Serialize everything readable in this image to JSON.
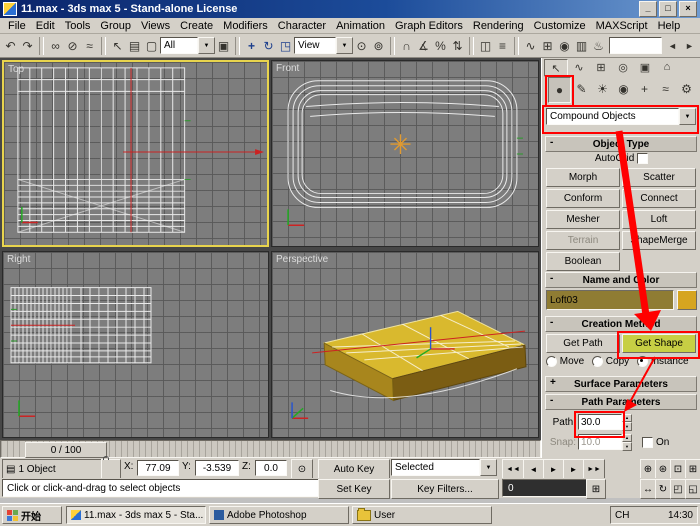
{
  "title_bar": {
    "title": "11.max - 3ds max 5 - Stand-alone License",
    "minimize": "_",
    "maximize": "□",
    "close": "×"
  },
  "menu_bar": {
    "items": [
      "File",
      "Edit",
      "Tools",
      "Group",
      "Views",
      "Create",
      "Modifiers",
      "Character",
      "Animation",
      "Graph Editors",
      "Rendering",
      "Customize",
      "MAXScript",
      "Help"
    ]
  },
  "toolbar": {
    "selection_filter": "All",
    "coord_system": "View"
  },
  "icons": {
    "undo": "↶",
    "redo": "↷",
    "select_link": "∞",
    "unlink": "⊘",
    "bind_spacewarp": "≈",
    "select_object": "↖",
    "select_by_name": "▤",
    "region_select": "▢",
    "window_crossing": "▣",
    "select_move": "+",
    "select_rotate": "↻",
    "select_scale": "◳",
    "use_center": "⊙",
    "manipulate": "⊚",
    "snap_toggle": "∩",
    "angle_snap": "∡",
    "percent_snap": "%",
    "spinner_snap": "⇅",
    "mirror": "◫",
    "align": "≡",
    "curve_editor": "∿",
    "schematic_view": "⊞",
    "material_editor": "◉",
    "render_scene": "▥",
    "quick_render": "♨",
    "scroll_left": "◄",
    "scroll_right": "►",
    "dropdown_arrow": "▼",
    "spin_up": "▲",
    "spin_down": "▼",
    "tab_create": "↖",
    "tab_modify": "∿",
    "tab_hierarchy": "⊞",
    "tab_motion": "◎",
    "tab_display": "▣",
    "tab_utilities": "⌂",
    "cat_geometry": "●",
    "cat_shapes": "✎",
    "cat_lights": "☀",
    "cat_cameras": "◉",
    "cat_helpers": "+",
    "cat_spacewarps": "≈",
    "cat_systems": "⚙",
    "go_start": "◄◄",
    "prev_frame": "◄",
    "play": "►",
    "next_frame": "►",
    "go_end": "►►",
    "zoom": "⊕",
    "zoom_all": "⊛",
    "zoom_extents": "⊡",
    "zoom_extents_all": "⊞",
    "pan": "↔",
    "arc_rotate": "↻",
    "region_zoom": "◰",
    "minmax_toggle": "◱",
    "selection_grid": "▤",
    "key_toggle": "⊙",
    "time_config": "⊞"
  },
  "viewports": {
    "top": "Top",
    "front": "Front",
    "right": "Right",
    "perspective": "Perspective"
  },
  "timeline": {
    "slider_label": "0 / 100"
  },
  "command_panel": {
    "category_dropdown": "Compound Objects",
    "autogrid": "AutoGrid",
    "rollouts": {
      "object_type": {
        "state": "-",
        "label": "Object Type"
      },
      "name_color": {
        "state": "-",
        "label": "Name and Color"
      },
      "creation": {
        "state": "-",
        "label": "Creation Method"
      },
      "surface": {
        "state": "+",
        "label": "Surface Parameters"
      },
      "path": {
        "state": "-",
        "label": "Path Parameters"
      }
    },
    "buttons": {
      "morph": "Morph",
      "scatter": "Scatter",
      "conform": "Conform",
      "connect": "Connect",
      "mesher": "Mesher",
      "loft": "Loft",
      "terrain": "Terrain",
      "shapemerge": "ShapeMerge",
      "boolean": "Boolean"
    },
    "object_name": "Loft03",
    "creation": {
      "get_path": "Get Path",
      "get_shape": "Get Shape",
      "move": "Move",
      "copy": "Copy",
      "instance": "Instance"
    },
    "path_params": {
      "path_label": "Path:",
      "path_value": "30.0",
      "snap_label": "Snap:",
      "snap_value": "10.0",
      "on": "On"
    }
  },
  "status_bar": {
    "object_count": "1 Object",
    "x_label": "X:",
    "x_value": "77.09",
    "y_label": "Y:",
    "y_value": "-3.539",
    "z_label": "Z:",
    "z_value": "0.0",
    "prompt": "Click or click-and-drag to select objects",
    "auto_key": "Auto Key",
    "set_key": "Set Key",
    "selected": "Selected",
    "key_filters": "Key Filters...",
    "frame": "0"
  },
  "taskbar": {
    "start": "开始",
    "tasks": [
      "11.max - 3ds max 5 - Sta...",
      "Adobe Photoshop",
      "User"
    ],
    "input_indicator": "CH",
    "clock": "14:30"
  },
  "colors": {
    "annotation": "#ff0000",
    "active_viewport": "#e8d44d",
    "loft_gold": "#d9b92e",
    "active_button": "#c7cf44",
    "name_field": "#8f7c33"
  }
}
